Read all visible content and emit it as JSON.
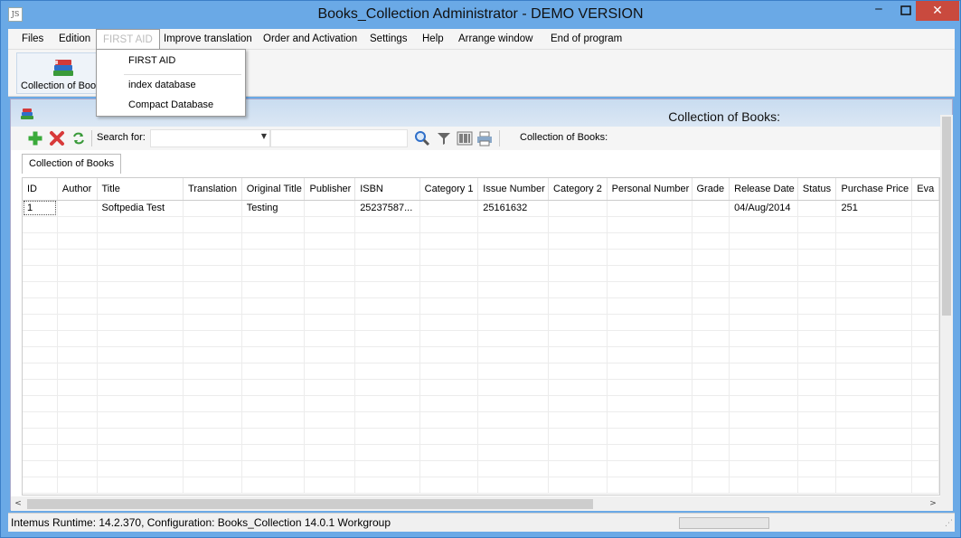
{
  "window": {
    "title": "Books_Collection  Administrator - DEMO VERSION",
    "app_icon": "JS",
    "minimize_glyph": "‒",
    "close_glyph": "✕"
  },
  "menu": {
    "items": [
      {
        "label": "Files"
      },
      {
        "label": "Edition"
      },
      {
        "label": "FIRST AID"
      },
      {
        "label": "Improve translation"
      },
      {
        "label": "Order and Activation"
      },
      {
        "label": "Settings"
      },
      {
        "label": "Help"
      },
      {
        "label": "Arrange window"
      },
      {
        "label": "End of program"
      }
    ],
    "open_menu": "FIRST AID"
  },
  "dropdown": {
    "items": [
      {
        "label": "FIRST AID"
      },
      {
        "label": "index database"
      },
      {
        "label": "Compact Database"
      }
    ]
  },
  "ribbon": {
    "button_label": "Collection of Books"
  },
  "child_window": {
    "title": "Collection of Books:"
  },
  "toolbar": {
    "search_label": "Search for:",
    "search_combo_value": "",
    "search_input_value": "",
    "collection_label": "Collection of Books:",
    "combo_arrow": "▼"
  },
  "tabs": [
    {
      "label": "Collection of Books",
      "active": true
    }
  ],
  "grid": {
    "columns": [
      "ID",
      "Author",
      "Title",
      "Translation",
      "Original Title",
      "Publisher",
      "ISBN",
      "Category 1",
      "Issue Number",
      "Category 2",
      "Personal Number",
      "Grade",
      "Release Date",
      "Status",
      "Purchase Price",
      "Eva"
    ],
    "rows": [
      [
        "1",
        "",
        "Softpedia Test",
        "",
        "Testing",
        "",
        "25237587...",
        "",
        "25161632",
        "",
        "",
        "",
        "04/Aug/2014",
        "",
        "251",
        ""
      ]
    ]
  },
  "scroll": {
    "left_glyph": "<",
    "right_glyph": ">"
  },
  "status": {
    "text": "Intemus Runtime: 14.2.370,  Configuration: Books_Collection 14.0.1 Workgroup",
    "grip_glyph": "⋰"
  }
}
